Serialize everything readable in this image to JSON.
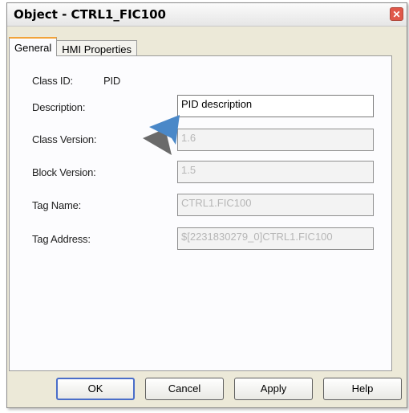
{
  "window": {
    "title": "Object - CTRL1_FIC100",
    "close_glyph": "✕"
  },
  "tabs": [
    {
      "label": "General",
      "active": true
    },
    {
      "label": "HMI Properties",
      "active": false
    }
  ],
  "fields": {
    "class_id_label": "Class ID:",
    "class_id_value": "PID",
    "description_label": "Description:",
    "description_value": "PID description",
    "class_version_label": "Class Version:",
    "class_version_value": "1.6",
    "block_version_label": "Block Version:",
    "block_version_value": "1.5",
    "tag_name_label": "Tag Name:",
    "tag_name_value": "CTRL1.FIC100",
    "tag_address_label": "Tag Address:",
    "tag_address_value": "$[2231830279_0]CTRL1.FIC100"
  },
  "buttons": {
    "ok": "OK",
    "cancel": "Cancel",
    "apply": "Apply",
    "help": "Help"
  },
  "colors": {
    "pointer_arrow": "#4a88c8",
    "default_button_border": "#4a6ec9"
  }
}
